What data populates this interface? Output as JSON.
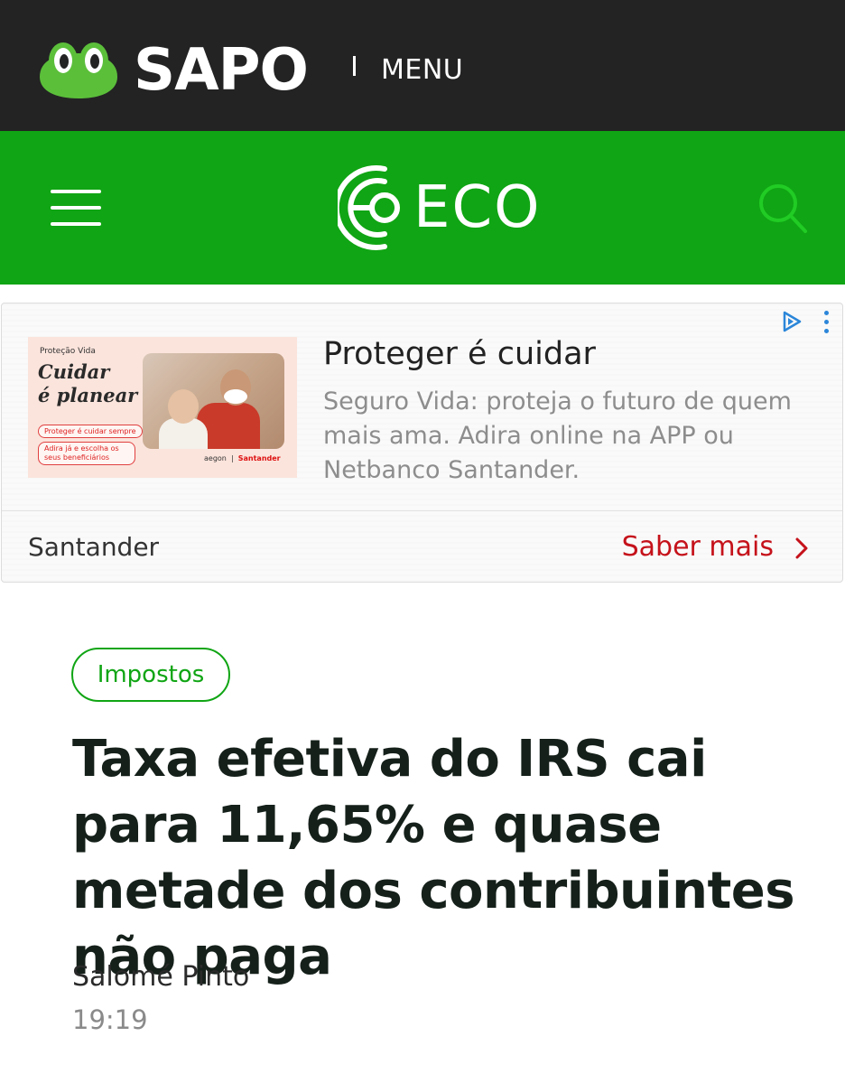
{
  "sapo_bar": {
    "brand": "SAPO",
    "separator": "I",
    "menu_label": "MENU"
  },
  "eco_bar": {
    "brand": "ECO",
    "menu_icon": "hamburger-icon",
    "search_icon": "search-icon"
  },
  "ad": {
    "image": {
      "tag": "Proteção Vida",
      "headline_line1": "Cuidar",
      "headline_line2": "é planear",
      "pill1": "Proteger é cuidar sempre",
      "pill2": "Adira já e escolha os seus beneficiários",
      "brand1": "aegon",
      "brand2": "Santander"
    },
    "title": "Proteger é cuidar",
    "description": "Seguro Vida: proteja o futuro de quem mais ama. Adira online na APP ou Netbanco Santander.",
    "advertiser": "Santander",
    "cta": "Saber mais",
    "adchoices_icon": "adchoices-icon",
    "more_icon": "kebab-menu-icon"
  },
  "article": {
    "category": "Impostos",
    "headline": "Taxa efetiva do IRS cai para 11,65% e quase metade dos contribuintes não paga",
    "author": "Salomé Pinto",
    "time": "19:19"
  },
  "colors": {
    "sapo_bar": "#232323",
    "eco_green": "#10a514",
    "cta_red": "#c5121b",
    "search_icon": "#21cc24"
  }
}
